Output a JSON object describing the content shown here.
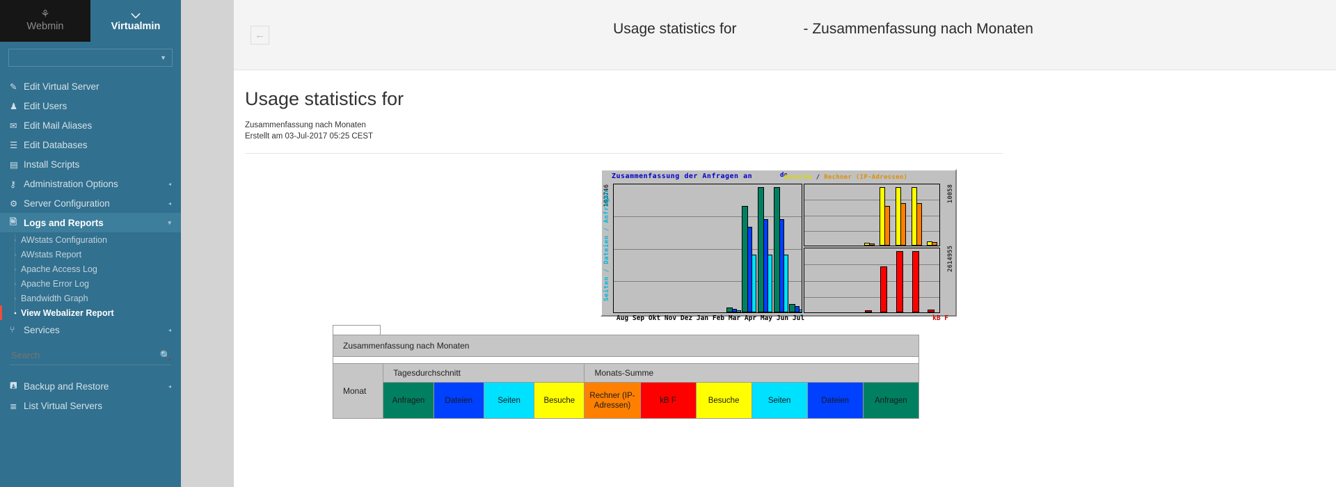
{
  "sidebar": {
    "tabs": [
      {
        "label": "Webmin",
        "icon": "webmin-logo-icon",
        "glyph": "⚘",
        "active": false
      },
      {
        "label": "Virtualmin",
        "icon": "chevron-down-icon",
        "glyph": "⌵",
        "active": true
      }
    ],
    "server_select": {
      "value": "",
      "caret": "▼"
    },
    "items": [
      {
        "label": "Edit Virtual Server",
        "icon": "edit-server-icon",
        "glyph": "✎",
        "arrow": ""
      },
      {
        "label": "Edit Users",
        "icon": "users-icon",
        "glyph": "♟",
        "arrow": ""
      },
      {
        "label": "Edit Mail Aliases",
        "icon": "envelope-icon",
        "glyph": "✉",
        "arrow": ""
      },
      {
        "label": "Edit Databases",
        "icon": "database-icon",
        "glyph": "☰",
        "arrow": ""
      },
      {
        "label": "Install Scripts",
        "icon": "install-scripts-icon",
        "glyph": "▤",
        "arrow": ""
      },
      {
        "label": "Administration Options",
        "icon": "wrench-icon",
        "glyph": "⚷",
        "arrow": "◂"
      },
      {
        "label": "Server Configuration",
        "icon": "gears-icon",
        "glyph": "⚙",
        "arrow": "◂"
      }
    ],
    "logs_section": {
      "label": "Logs and Reports",
      "icon": "document-icon",
      "glyph": "὜b",
      "arrow": "▾",
      "children": [
        {
          "label": "AWstats Configuration",
          "current": false
        },
        {
          "label": "AWstats Report",
          "current": false
        },
        {
          "label": "Apache Access Log",
          "current": false
        },
        {
          "label": "Apache Error Log",
          "current": false
        },
        {
          "label": "Bandwidth Graph",
          "current": false
        },
        {
          "label": "View Webalizer Report",
          "current": true
        }
      ]
    },
    "services": {
      "label": "Services",
      "icon": "services-icon",
      "glyph": "⑂",
      "arrow": "◂"
    },
    "search": {
      "placeholder": "Search",
      "value": "",
      "icon": "search-icon",
      "glyph": "⚲"
    },
    "bottom_items": [
      {
        "label": "Backup and Restore",
        "icon": "save-disk-icon",
        "glyph": "⛃",
        "arrow": "◂"
      },
      {
        "label": "List Virtual Servers",
        "icon": "list-servers-icon",
        "glyph": "≣",
        "arrow": ""
      }
    ],
    "accent_color": "#31708e",
    "active_marker_color": "#f24c3d"
  },
  "topbar": {
    "back_icon": "arrow-left-icon",
    "back_glyph": "←",
    "title_prefix": "Usage statistics for",
    "title_suffix": "- Zusammenfassung nach Monaten"
  },
  "page": {
    "title": "Usage statistics for",
    "subtitle": "Zusammenfassung nach Monaten",
    "created": "Erstellt am 03-Jul-2017 05:25 CEST"
  },
  "chart_data": {
    "type": "bar",
    "title": "Zusammenfassung der Anfragen an",
    "title2_visits": "Besuche",
    "title2_sep": "/",
    "title2_hosts": "Rechner (IP-Adressen)",
    "domain_fragment": "de",
    "ylabel_left": "Seiten / Dateien / Anfragen",
    "ymax_left": "103746",
    "ymax_right_visits": "10058",
    "ymax_right_kb": "2614955",
    "kb_label": "kB F",
    "categories": [
      "Aug",
      "Sep",
      "Okt",
      "Nov",
      "Dez",
      "Jan",
      "Feb",
      "Mar",
      "Apr",
      "May",
      "Jun",
      "Jul"
    ],
    "ylim_left": [
      0,
      103746
    ],
    "ylim_visits": [
      0,
      10058
    ],
    "ylim_kb": [
      0,
      2614955
    ],
    "grid": true,
    "legend": "inline-axis-colors",
    "series": [
      {
        "name": "Anfragen",
        "color": "#008060",
        "panel": "main",
        "values": [
          0,
          0,
          0,
          0,
          0,
          0,
          0,
          4300,
          88000,
          103746,
          103746,
          7000
        ]
      },
      {
        "name": "Dateien",
        "color": "#0040ff",
        "panel": "main",
        "values": [
          0,
          0,
          0,
          0,
          0,
          0,
          0,
          3000,
          71000,
          77000,
          77000,
          5000
        ]
      },
      {
        "name": "Seiten",
        "color": "#00e0ff",
        "panel": "main",
        "values": [
          0,
          0,
          0,
          0,
          0,
          0,
          0,
          2000,
          48000,
          48000,
          48000,
          2500
        ]
      },
      {
        "name": "Besuche",
        "color": "#ffff00",
        "panel": "visits",
        "values": [
          0,
          0,
          0,
          0,
          0,
          0,
          0,
          500,
          10058,
          10058,
          10058,
          700
        ]
      },
      {
        "name": "Rechner (IP-Adressen)",
        "color": "#ff8000",
        "panel": "visits",
        "values": [
          0,
          0,
          0,
          0,
          0,
          0,
          0,
          380,
          6800,
          7300,
          7300,
          620
        ]
      },
      {
        "name": "kB F",
        "color": "#ff0000",
        "panel": "kb",
        "values": [
          0,
          0,
          0,
          0,
          0,
          0,
          0,
          90000,
          1950000,
          2614955,
          2614955,
          110000
        ]
      }
    ]
  },
  "table": {
    "caption": "Zusammenfassung nach Monaten",
    "group_headers": [
      {
        "label": "",
        "key": "monat-corner"
      },
      {
        "label": "Tagesdurchschnitt",
        "key": "daily-average"
      },
      {
        "label": "Monats-Summe",
        "key": "monthly-total"
      }
    ],
    "monat_label": "Monat",
    "columns": [
      {
        "label": "Anfragen",
        "color": "#008060",
        "group": "Tagesdurchschnitt"
      },
      {
        "label": "Dateien",
        "color": "#0040ff",
        "group": "Tagesdurchschnitt"
      },
      {
        "label": "Seiten",
        "color": "#00e0ff",
        "group": "Tagesdurchschnitt"
      },
      {
        "label": "Besuche",
        "color": "#ffff00",
        "group": "Tagesdurchschnitt"
      },
      {
        "label": "Rechner (IP-Adressen)",
        "color": "#ff8000",
        "group": "Monats-Summe"
      },
      {
        "label": "kB F",
        "color": "#ff0000",
        "group": "Monats-Summe"
      },
      {
        "label": "Besuche",
        "color": "#ffff00",
        "group": "Monats-Summe"
      },
      {
        "label": "Seiten",
        "color": "#00e0ff",
        "group": "Monats-Summe"
      },
      {
        "label": "Dateien",
        "color": "#0040ff",
        "group": "Monats-Summe"
      },
      {
        "label": "Anfragen",
        "color": "#008060",
        "group": "Monats-Summe"
      }
    ]
  }
}
